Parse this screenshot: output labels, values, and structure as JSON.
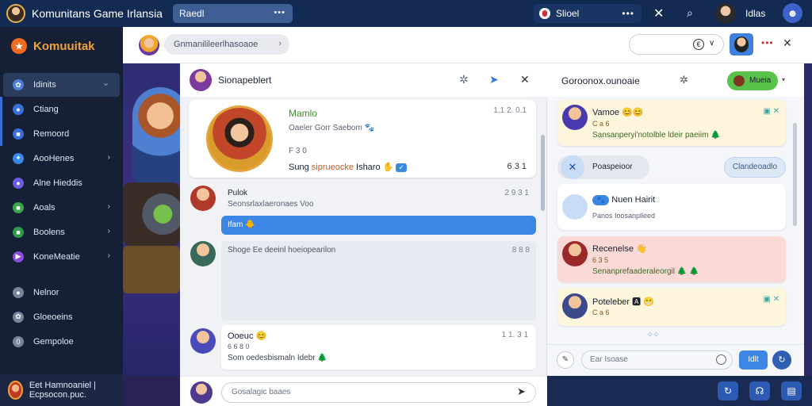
{
  "topbar": {
    "title": "Komunitans Game Irlansia",
    "search_value": "Raedl",
    "search_dots": "•••",
    "status_label": "Slioel",
    "status_dots": "•••",
    "close_glyph": "✕",
    "bell_glyph": "⌕",
    "user_name": "Idlas",
    "badge_glyph": "☻"
  },
  "sidebar": {
    "brand": "Komuuitak",
    "brand_star": "★",
    "items": [
      {
        "label": "Idinits",
        "icon": "users-icon",
        "glyph": "✿",
        "color": "#4d7fd6",
        "chevron": true,
        "active": true
      },
      {
        "label": "Ctiang",
        "icon": "chat-icon",
        "glyph": "●",
        "color": "#3a6fd6",
        "chevron": false,
        "sub": true
      },
      {
        "label": "Remoord",
        "icon": "record-icon",
        "glyph": "■",
        "color": "#3a6fd6",
        "chevron": false,
        "sub": true
      },
      {
        "label": "AooHenes",
        "icon": "game-icon",
        "glyph": "✦",
        "color": "#3a89e8",
        "chevron": true
      },
      {
        "label": "Alne Hieddis",
        "icon": "hero-icon",
        "glyph": "●",
        "color": "#6b5ce0",
        "chevron": false
      },
      {
        "label": "Aoals",
        "icon": "goals-icon",
        "glyph": "■",
        "color": "#3aa64a",
        "chevron": true
      },
      {
        "label": "Boolens",
        "icon": "rank-icon",
        "glyph": "■",
        "color": "#2f9a4a",
        "chevron": true
      },
      {
        "label": "KoneMeatie",
        "icon": "media-icon",
        "glyph": "▶",
        "color": "#8a4fd6",
        "chevron": true
      }
    ],
    "lower_items": [
      {
        "label": "Nelnor",
        "icon": "profile-icon",
        "glyph": "●",
        "color": "#7a8498"
      },
      {
        "label": "Gloeoeins",
        "icon": "settings-icon",
        "glyph": "✿",
        "color": "#7a8498"
      },
      {
        "label": "Gempoloe",
        "icon": "info-icon",
        "glyph": "0",
        "color": "#7a8498"
      }
    ],
    "footer_text": "Eet Hamnoaniel | Ecpsocon.puc."
  },
  "subbar": {
    "pill_text": "Gnmanilileerlhasoaoe",
    "pill_arrow": "›",
    "select_icon": "€",
    "select_chevron": "∨",
    "kebab": "•••",
    "close": "✕"
  },
  "chat": {
    "header_name": "Sionapeblert",
    "header_icons": {
      "star": "✲",
      "pin": "➤",
      "close": "✕"
    },
    "featured": {
      "title": "Mamlo",
      "time": "1.1 2. 0.1",
      "line1": "Oaeler Gorr Saebom 🐾",
      "line2": "F 3 0",
      "line3_prefix": "Sung ",
      "line3_highlight": "siprueocke",
      "line3_suffix": " Isharo ✋",
      "line3_tag": "✓",
      "counts": "6 3 1"
    },
    "rows": [
      {
        "name": "Pulok",
        "sub": "Seonsrlaxlaeronaes Voo",
        "time": "2 9 3 1"
      },
      {
        "bubble": "Ifam 🐥"
      },
      {
        "name": "Shoge Ee deeinl hoeiopearilon",
        "time": "8 8 8"
      },
      {
        "name": "Ooeuc 😊",
        "sub1": "6 6 8 0",
        "sub2": "Som oedesbismaln Idebr 🌲",
        "time": "1 1. 3 1"
      }
    ],
    "composer_placeholder": "Gosalagic baaes",
    "send_glyph": "➤"
  },
  "right_panel": {
    "title": "Goroonox.ounoaie",
    "pin": "✲",
    "button_label": "Mueia",
    "chevron": "▾",
    "cards": [
      {
        "name": "Vamoe 😊😊",
        "sub": "C a 6",
        "sub2": "Sansanperyi'notolble ldeir paeiim 🌲",
        "bg": "#fdf6dc"
      },
      {
        "name": "Nuen Hairit",
        "sub": "Panos Ioosanplleed",
        "tag": "🐾",
        "bg": "#ffffff"
      },
      {
        "name": "Recenelse 👋",
        "sub": "6 3 5",
        "sub2": "Senanprefaaderaleorgil 🌲 🌲",
        "bg": "#fbd9d6"
      },
      {
        "name": "Poteleber 🅰 😁",
        "sub": "C a 6",
        "bg": "#fdf6dc"
      }
    ],
    "mid_label": "Poaspeioor",
    "mid_right": "Clandeoadlo",
    "more": "○ ○",
    "compose_placeholder": "Ear Isoase",
    "send_label": "Idlt",
    "extra_glyph": "↻",
    "footer_icons": [
      "↻",
      "☊",
      "▤"
    ]
  }
}
